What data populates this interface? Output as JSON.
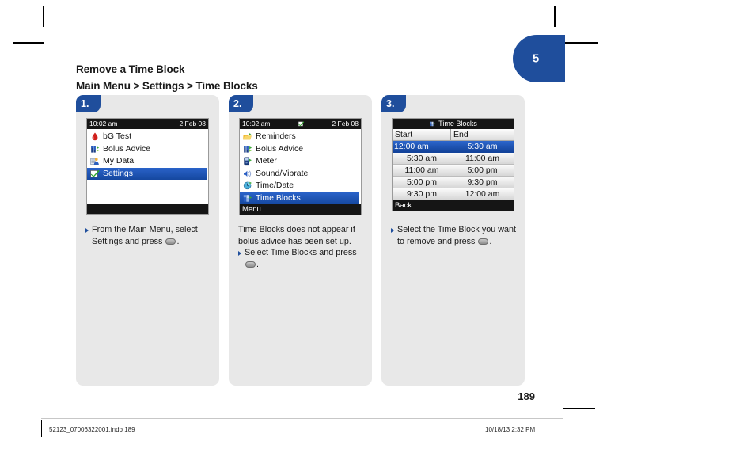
{
  "page": {
    "chapter_tab_number": "5",
    "folio": "189"
  },
  "heading": {
    "title": "Remove a Time Block",
    "breadcrumb": "Main Menu > Settings > Time Blocks"
  },
  "footer": {
    "left": "52123_07006322001.indb   189",
    "right": "10/18/13   2:32 PM"
  },
  "steps": [
    {
      "badge": "1.",
      "screen": {
        "statusbar": {
          "time": "10:02 am",
          "date": "2 Feb 08",
          "icon": ""
        },
        "items": [
          {
            "icon": "blood-drop-icon",
            "label": "bG Test",
            "selected": false
          },
          {
            "icon": "bolus-advice-icon",
            "label": "Bolus Advice",
            "selected": false
          },
          {
            "icon": "my-data-icon",
            "label": "My Data",
            "selected": false
          },
          {
            "icon": "settings-check-icon",
            "label": "Settings",
            "selected": true
          }
        ],
        "softkey": ""
      },
      "caption": {
        "bullets": [
          "From the Main Menu, select Settings and press "
        ],
        "plain": []
      }
    },
    {
      "badge": "2.",
      "screen": {
        "statusbar": {
          "time": "10:02 am",
          "date": "2 Feb 08",
          "icon": "settings-check-icon"
        },
        "items": [
          {
            "icon": "reminders-icon",
            "label": "Reminders",
            "selected": false
          },
          {
            "icon": "bolus-advice-icon",
            "label": "Bolus Advice",
            "selected": false
          },
          {
            "icon": "meter-icon",
            "label": "Meter",
            "selected": false
          },
          {
            "icon": "sound-vibrate-icon",
            "label": "Sound/Vibrate",
            "selected": false
          },
          {
            "icon": "time-date-icon",
            "label": "Time/Date",
            "selected": false
          },
          {
            "icon": "time-blocks-icon",
            "label": "Time Blocks",
            "selected": true
          }
        ],
        "softkey": "Menu"
      },
      "caption": {
        "plain": [
          "Time Blocks does not appear if bolus advice has been set up."
        ],
        "bullets": [
          "Select Time Blocks and press "
        ]
      }
    },
    {
      "badge": "3.",
      "screen": {
        "title": "Time Blocks",
        "title_icon": "time-blocks-icon",
        "columns": [
          "Start",
          "End"
        ],
        "rows": [
          {
            "start": "12:00 am",
            "end": "5:30 am",
            "selected": true
          },
          {
            "start": "5:30 am",
            "end": "11:00 am",
            "selected": false
          },
          {
            "start": "11:00 am",
            "end": "5:00 pm",
            "selected": false
          },
          {
            "start": "5:00 pm",
            "end": "9:30 pm",
            "selected": false
          },
          {
            "start": "9:30 pm",
            "end": "12:00 am",
            "selected": false
          }
        ],
        "softkey": "Back"
      },
      "caption": {
        "bullets": [
          "Select the Time Block you want to remove and press "
        ],
        "plain": []
      }
    }
  ],
  "colors": {
    "brand_blue": "#1f4e9c",
    "panel_gray": "#e8e8e8",
    "screen_dark": "#151515",
    "highlight_blue": "#15479f"
  }
}
